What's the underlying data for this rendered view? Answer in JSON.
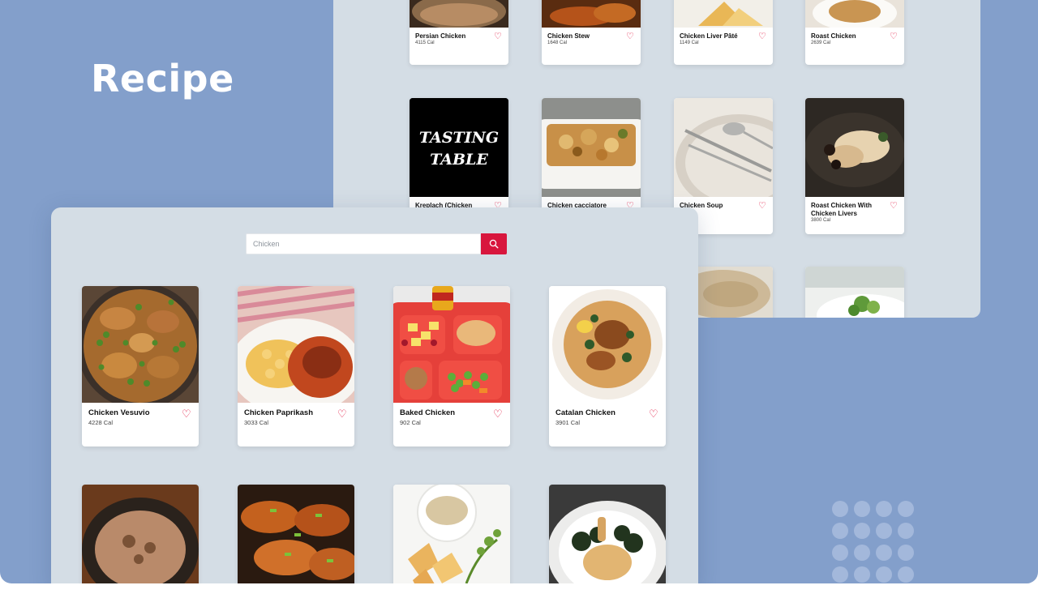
{
  "brand": {
    "title": "Recipe"
  },
  "search": {
    "placeholder": "Chicken"
  },
  "back_window": {
    "row1": [
      {
        "name": "Persian Chicken",
        "calories": "4115 Cal"
      },
      {
        "name": "Chicken Stew",
        "calories": "1648 Cal"
      },
      {
        "name": "Chicken Liver Pâté",
        "calories": "1149 Cal"
      },
      {
        "name": "Roast Chicken",
        "calories": "2639 Cal"
      }
    ],
    "row2": [
      {
        "name": "Kreplach (Chicken",
        "calories": ""
      },
      {
        "name": "Chicken cacciatore",
        "calories": ""
      },
      {
        "name": "Chicken Soup",
        "calories": ""
      },
      {
        "name": "Roast Chicken With Chicken Livers",
        "calories": "3800 Cal"
      }
    ],
    "logo_text": [
      "TASTING",
      "TABLE"
    ]
  },
  "front_window": {
    "row1": [
      {
        "name": "Chicken Vesuvio",
        "calories": "4228 Cal"
      },
      {
        "name": "Chicken Paprikash",
        "calories": "3033 Cal"
      },
      {
        "name": "Baked Chicken",
        "calories": "902 Cal"
      },
      {
        "name": "Catalan Chicken",
        "calories": "3901 Cal"
      }
    ]
  },
  "colors": {
    "background": "#839fcb",
    "panel": "#d4dde5",
    "accent": "#d8163d",
    "heart": "#e0103a"
  },
  "icons": {
    "search": "search-icon",
    "favorite": "heart-icon"
  }
}
